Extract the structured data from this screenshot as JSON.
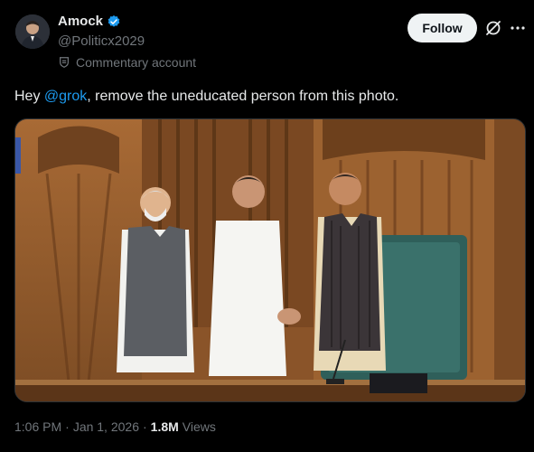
{
  "author": {
    "display_name": "Amock",
    "handle": "@Politicx2029",
    "label": "Commentary account"
  },
  "actions": {
    "follow_label": "Follow"
  },
  "tweet": {
    "text_before": "Hey ",
    "mention": "@grok",
    "text_after": ", remove the uneducated person from this photo."
  },
  "meta": {
    "time": "1:06 PM",
    "separator": "·",
    "date": "Jan 1, 2026",
    "views_count": "1.8M",
    "views_label": "Views"
  },
  "colors": {
    "accent": "#1d9bf0",
    "verified": "#1d9bf0",
    "background": "#000000",
    "secondary_text": "#71767b"
  },
  "icons": [
    "verified-badge-icon",
    "grok-icon",
    "more-icon",
    "commentary-label-icon"
  ]
}
